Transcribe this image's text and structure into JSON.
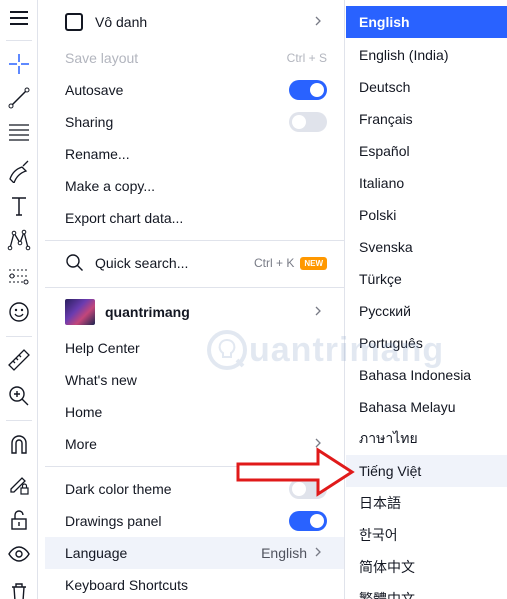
{
  "toolbar": {
    "icons": [
      "menu-icon",
      "crosshair-icon",
      "trend-line-icon",
      "horizontal-lines-icon",
      "brush-icon",
      "text-icon",
      "pattern-icon",
      "forecast-icon",
      "emoji-icon",
      "ruler-icon",
      "zoom-in-icon",
      "magnet-icon",
      "lock-drawing-icon",
      "lock-icon",
      "eye-icon"
    ]
  },
  "menu": {
    "layout_name": "Vô danh",
    "save_layout": "Save layout",
    "save_shortcut": "Ctrl + S",
    "autosave": "Autosave",
    "sharing": "Sharing",
    "rename": "Rename...",
    "make_copy": "Make a copy...",
    "export": "Export chart data...",
    "quick_search": "Quick search...",
    "quick_search_shortcut": "Ctrl + K",
    "new_badge": "NEW",
    "username": "quantrimang",
    "help_center": "Help Center",
    "whats_new": "What's new",
    "home": "Home",
    "more": "More",
    "dark_theme": "Dark color theme",
    "drawings_panel": "Drawings panel",
    "language": "Language",
    "language_value": "English",
    "keyboard_shortcuts": "Keyboard Shortcuts"
  },
  "languages": [
    "English",
    "English (India)",
    "Deutsch",
    "Français",
    "Español",
    "Italiano",
    "Polski",
    "Svenska",
    "Türkçe",
    "Русский",
    "Português",
    "Bahasa Indonesia",
    "Bahasa Melayu",
    "ภาษาไทย",
    "Tiếng Việt",
    "日本語",
    "한국어",
    "简体中文",
    "繁體中文"
  ],
  "watermark": "uantrimang",
  "colors": {
    "accent": "#2962ff",
    "badge": "#ff9800",
    "arrow": "#e01a1a"
  }
}
